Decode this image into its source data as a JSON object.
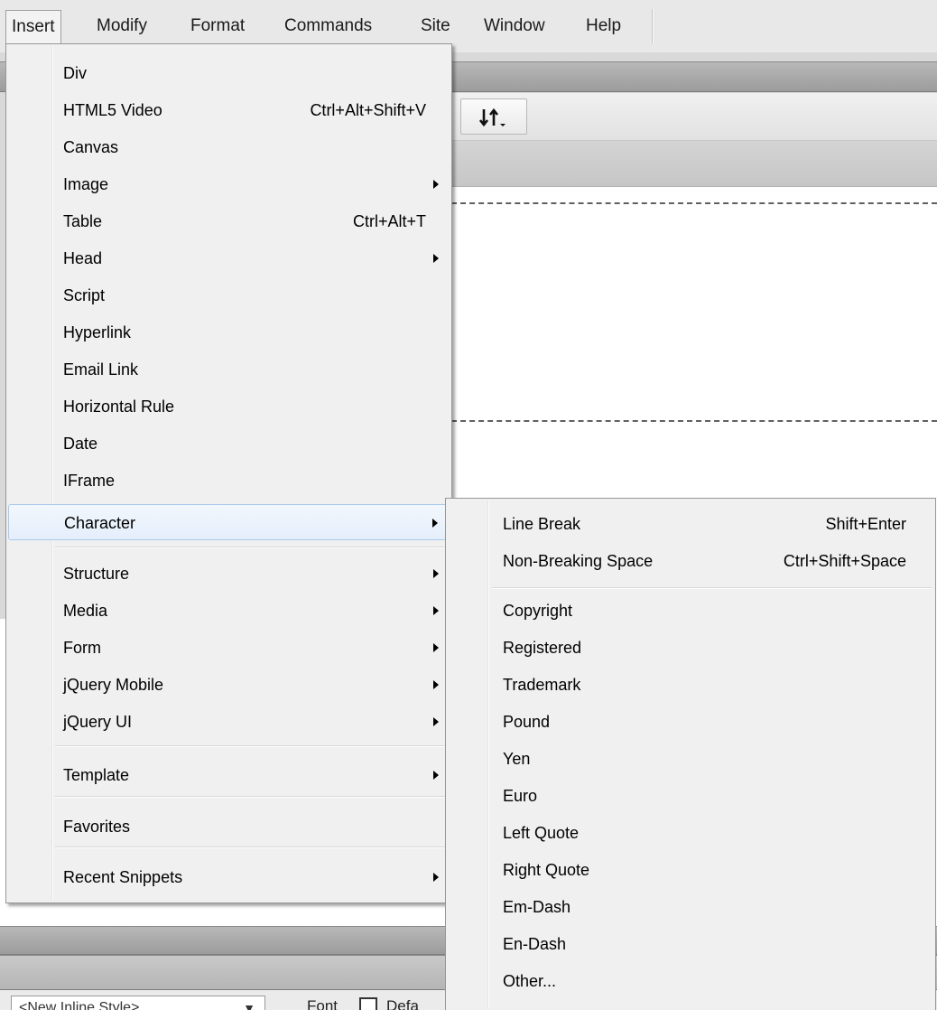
{
  "menubar": {
    "items": [
      "Insert",
      "Modify",
      "Format",
      "Commands",
      "Site",
      "Window",
      "Help"
    ]
  },
  "style_select": {
    "value": "<New Inline Style>"
  },
  "properties": {
    "font_label": "Font",
    "font_value": "Defa"
  },
  "insert_menu": {
    "items": [
      {
        "label": "Div",
        "shortcut": "",
        "submenu": false
      },
      {
        "label": "HTML5 Video",
        "shortcut": "Ctrl+Alt+Shift+V",
        "submenu": false
      },
      {
        "label": "Canvas",
        "shortcut": "",
        "submenu": false
      },
      {
        "label": "Image",
        "shortcut": "",
        "submenu": true
      },
      {
        "label": "Table",
        "shortcut": "Ctrl+Alt+T",
        "submenu": false
      },
      {
        "label": "Head",
        "shortcut": "",
        "submenu": true
      },
      {
        "label": "Script",
        "shortcut": "",
        "submenu": false
      },
      {
        "label": "Hyperlink",
        "shortcut": "",
        "submenu": false
      },
      {
        "label": "Email Link",
        "shortcut": "",
        "submenu": false
      },
      {
        "label": "Horizontal Rule",
        "shortcut": "",
        "submenu": false
      },
      {
        "label": "Date",
        "shortcut": "",
        "submenu": false
      },
      {
        "label": "IFrame",
        "shortcut": "",
        "submenu": false
      },
      {
        "label": "Character",
        "shortcut": "",
        "submenu": true,
        "highlighted": true
      },
      {
        "label": "Structure",
        "shortcut": "",
        "submenu": true
      },
      {
        "label": "Media",
        "shortcut": "",
        "submenu": true
      },
      {
        "label": "Form",
        "shortcut": "",
        "submenu": true
      },
      {
        "label": "jQuery Mobile",
        "shortcut": "",
        "submenu": true
      },
      {
        "label": "jQuery UI",
        "shortcut": "",
        "submenu": true
      },
      {
        "label": "Template",
        "shortcut": "",
        "submenu": true
      },
      {
        "label": "Favorites",
        "shortcut": "",
        "submenu": false
      },
      {
        "label": "Recent Snippets",
        "shortcut": "",
        "submenu": true
      }
    ]
  },
  "character_submenu": {
    "items": [
      {
        "label": "Line Break",
        "shortcut": "Shift+Enter"
      },
      {
        "label": "Non-Breaking Space",
        "shortcut": "Ctrl+Shift+Space"
      },
      {
        "label": "Copyright",
        "shortcut": ""
      },
      {
        "label": "Registered",
        "shortcut": ""
      },
      {
        "label": "Trademark",
        "shortcut": ""
      },
      {
        "label": "Pound",
        "shortcut": ""
      },
      {
        "label": "Yen",
        "shortcut": ""
      },
      {
        "label": "Euro",
        "shortcut": ""
      },
      {
        "label": "Left Quote",
        "shortcut": ""
      },
      {
        "label": "Right Quote",
        "shortcut": ""
      },
      {
        "label": "Em-Dash",
        "shortcut": ""
      },
      {
        "label": "En-Dash",
        "shortcut": ""
      },
      {
        "label": "Other...",
        "shortcut": ""
      }
    ]
  }
}
